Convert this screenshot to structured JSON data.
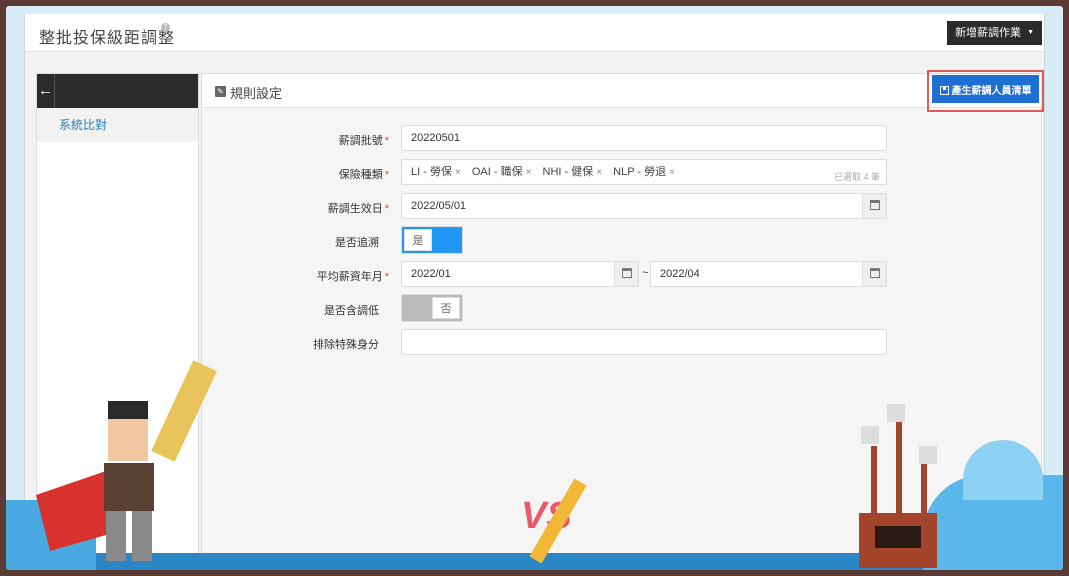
{
  "topbar": {
    "title": "整批投保級距調整",
    "help_icon": "?",
    "adjust_button": "新增薪調作業"
  },
  "sidebar": {
    "back_icon": "←",
    "items": [
      {
        "label": "系統比對"
      }
    ]
  },
  "panel": {
    "title": "規則設定",
    "generate_button": "產生薪調人員清單"
  },
  "form": {
    "batch_no": {
      "label": "薪調批號",
      "value": "20220501"
    },
    "insurance_type": {
      "label": "保險種類",
      "tags": [
        "LI - 勞保",
        "OAI - 職保",
        "NHI - 健保",
        "NLP - 勞退"
      ],
      "remove_mark": "×",
      "selected_count": "已選取 4 筆"
    },
    "effective_date": {
      "label": "薪調生效日",
      "value": "2022/05/01"
    },
    "retroactive": {
      "label": "是否追溯",
      "state": "是"
    },
    "avg_salary_month": {
      "label": "平均薪資年月",
      "from": "2022/01",
      "separator": "~",
      "to": "2022/04"
    },
    "include_lower": {
      "label": "是否含調低",
      "state": "否"
    },
    "exclude_identity": {
      "label": "排除特殊身分",
      "value": ""
    }
  },
  "required_mark": "*",
  "colors": {
    "accent": "#1d6fd1",
    "highlight": "#e05a5a",
    "toggle_on": "#2196f3",
    "dark": "#2b2b2b",
    "link": "#2a7fbf"
  }
}
